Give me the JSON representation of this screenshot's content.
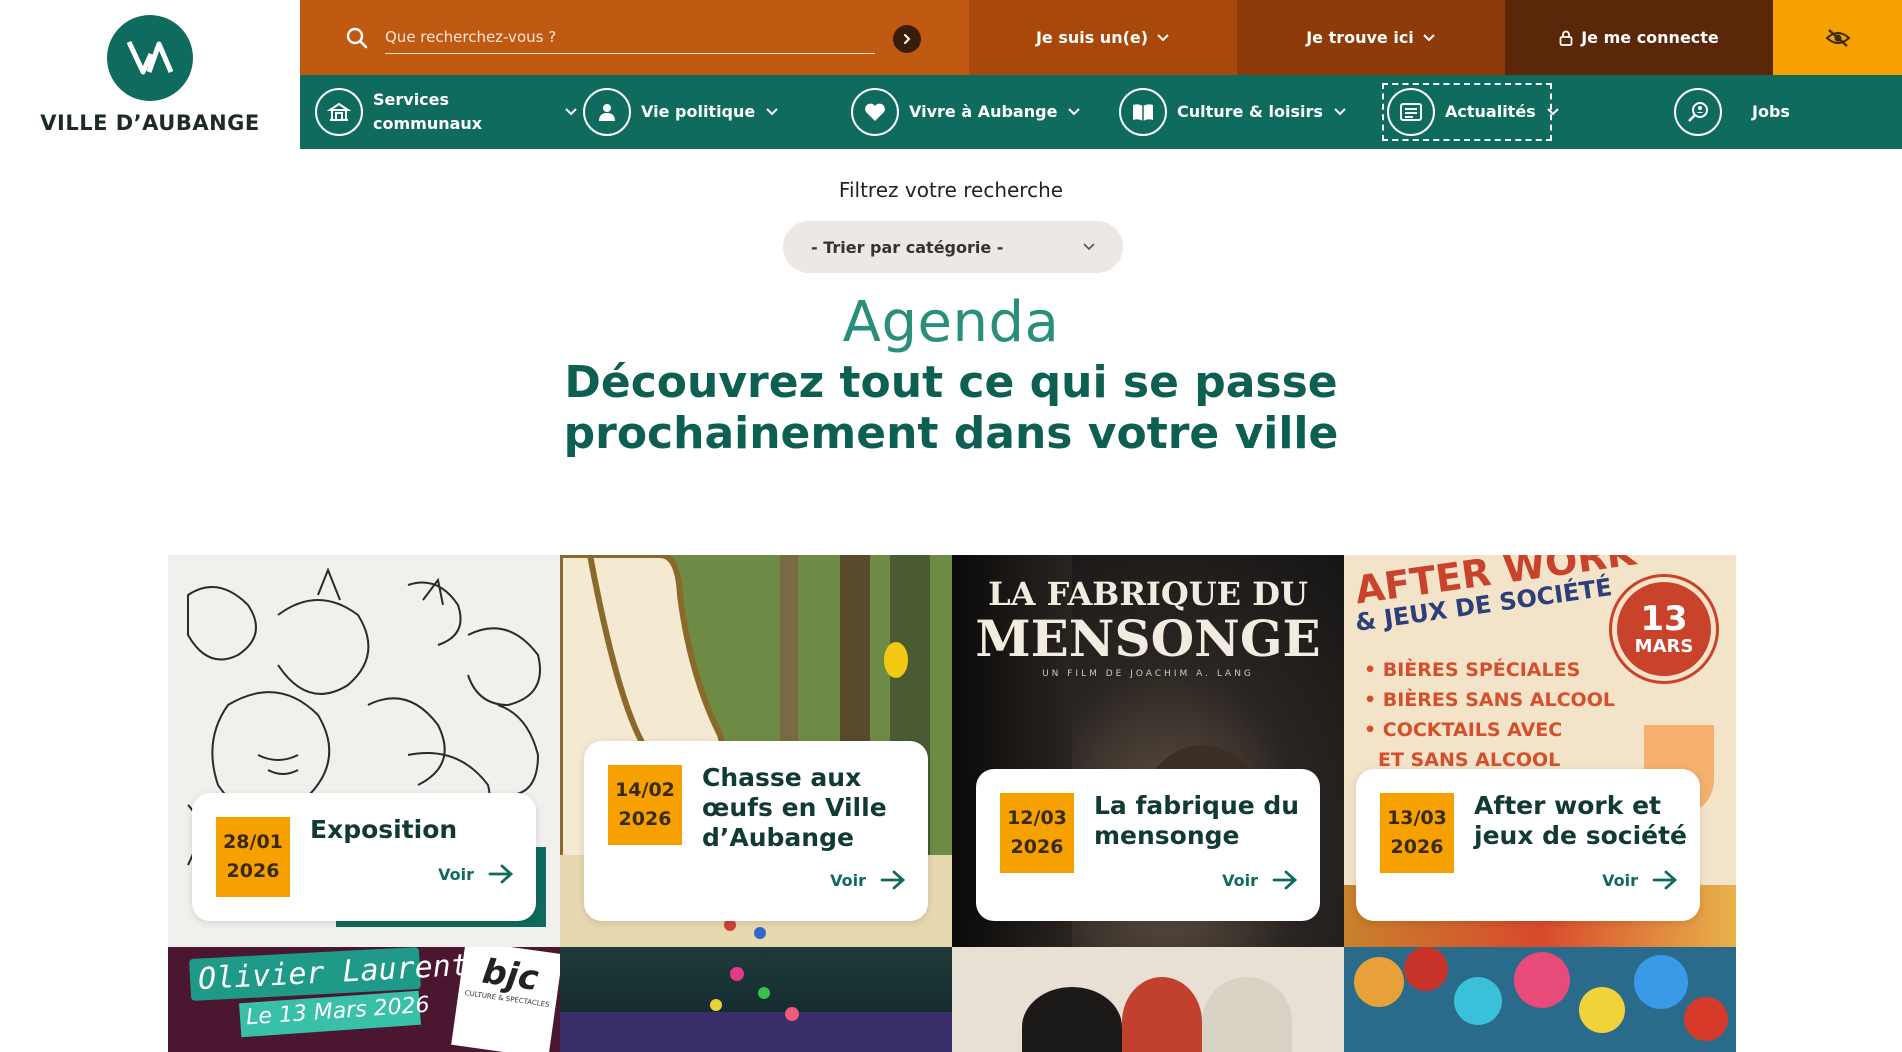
{
  "header": {
    "logo_text": "VILLE D’AUBANGE",
    "search": {
      "placeholder": "Que recherchez-vous ?"
    },
    "top_items": {
      "suis": "Je suis un(e)",
      "trouve": "Je trouve ici",
      "connecte": "Je me connecte"
    },
    "nav": {
      "services_line1": "Services",
      "services_line2": "communaux",
      "vie_politique": "Vie politique",
      "vivre": "Vivre à Aubange",
      "culture": "Culture & loisirs",
      "actualites": "Actualités",
      "jobs": "Jobs"
    }
  },
  "filter": {
    "label": "Filtrez votre recherche",
    "select_value": "- Trier par catégorie -"
  },
  "agenda": {
    "title": "Agenda",
    "subtitle_line1": "Découvrez tout ce qui se passe",
    "subtitle_line2": "prochainement dans votre ville"
  },
  "events": [
    {
      "date_day": "28/01",
      "date_year": "2026",
      "title_line1": "Exposition",
      "title_line2": "",
      "title_line3": "",
      "voir": "Voir"
    },
    {
      "date_day": "14/02",
      "date_year": "2026",
      "title_line1": "Chasse aux",
      "title_line2": "œufs en Ville",
      "title_line3": "d’Aubange",
      "voir": "Voir"
    },
    {
      "date_day": "12/03",
      "date_year": "2026",
      "title_line1": "La fabrique du",
      "title_line2": "mensonge",
      "title_line3": "",
      "voir": "Voir"
    },
    {
      "date_day": "13/03",
      "date_year": "2026",
      "title_line1": "After work et",
      "title_line2": "jeux de société",
      "title_line3": "",
      "voir": "Voir"
    }
  ],
  "posters": {
    "fabrique_title1": "LA FABRIQUE DU",
    "fabrique_title2": "MENSONGE",
    "fabrique_credit": "UN FILM DE JOACHIM A. LANG",
    "after_title1": "AFTER WORK",
    "after_title2": "& JEUX DE SOCIÉTÉ",
    "after_badge_day": "13",
    "after_badge_month": "MARS",
    "after_items": [
      "• BIÈRES SPÉCIALES",
      "• BIÈRES SANS ALCOOL",
      "• COCKTAILS AVEC",
      "ET SANS ALCOOL"
    ],
    "olivier_name": "Olivier Laurent",
    "olivier_date": "Le 13 Mars 2026",
    "bjc_logo": "bjc",
    "bjc_sub": "CULTURE & SPECTACLES"
  },
  "colors": {
    "brand_green": "#0e6b5e",
    "accent_orange": "#f6a100",
    "search_orange": "#c05a13"
  }
}
